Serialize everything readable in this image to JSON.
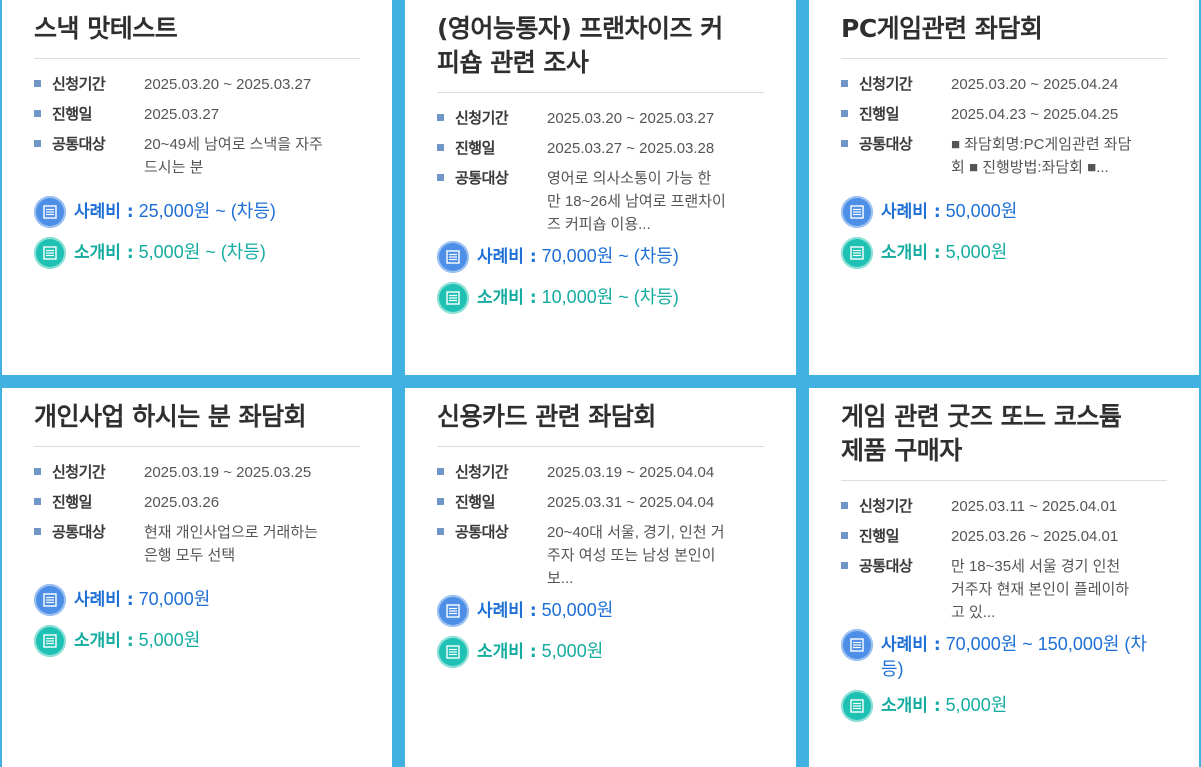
{
  "labels": {
    "apply_period": "신청기간",
    "event_date": "진행일",
    "target": "공통대상",
    "reward": "사례비 :",
    "referral": "소개비 :"
  },
  "colors": {
    "background": "#41b1e2",
    "reward_text": "#1e6fd6",
    "referral_text": "#14aca0",
    "bullet": "#6f95c9"
  },
  "cards": [
    {
      "title_lines": [
        "스낵 맛테스트"
      ],
      "apply_period": "2025.03.20 ~ 2025.03.27",
      "event_date": "2025.03.27",
      "target_lines": [
        "20~49세 남여로 스낵을 자주",
        "드시는 분"
      ],
      "reward": "25,000원 ~ (차등)",
      "referral": "5,000원 ~ (차등)"
    },
    {
      "title_lines": [
        "(영어능통자) 프랜차이즈 커",
        "피숍 관련 조사"
      ],
      "apply_period": "2025.03.20 ~ 2025.03.27",
      "event_date": "2025.03.27 ~ 2025.03.28",
      "target_lines": [
        "영어로 의사소통이 가능 한",
        "만 18~26세 남여로 프랜차이",
        "즈 커피숍 이용..."
      ],
      "reward": "70,000원 ~ (차등)",
      "referral": "10,000원 ~ (차등)"
    },
    {
      "title_lines": [
        "PC게임관련 좌담회"
      ],
      "apply_period": "2025.03.20 ~ 2025.04.24",
      "event_date": "2025.04.23 ~ 2025.04.25",
      "target_lines": [
        "■ 좌담회명:PC게임관련 좌담",
        "회 ■ 진행방법:좌담회 ■..."
      ],
      "reward": "50,000원",
      "referral": "5,000원"
    },
    {
      "title_lines": [
        "개인사업 하시는 분 좌담회"
      ],
      "apply_period": "2025.03.19 ~ 2025.03.25",
      "event_date": "2025.03.26",
      "target_lines": [
        "현재 개인사업으로 거래하는",
        "은행 모두 선택"
      ],
      "reward": "70,000원",
      "referral": "5,000원"
    },
    {
      "title_lines": [
        "신용카드 관련 좌담회"
      ],
      "apply_period": "2025.03.19 ~ 2025.04.04",
      "event_date": "2025.03.31 ~ 2025.04.04",
      "target_lines": [
        "20~40대 서울, 경기, 인천 거",
        "주자 여성 또는 남성 본인이",
        "보..."
      ],
      "reward": "50,000원",
      "referral": "5,000원"
    },
    {
      "title_lines": [
        "게임 관련 굿즈 또느 코스튬",
        "제품 구매자"
      ],
      "apply_period": "2025.03.11 ~ 2025.04.01",
      "event_date": "2025.03.26 ~ 2025.04.01",
      "target_lines": [
        "만 18~35세 서울 경기 인천",
        "거주자 현재 본인이 플레이하",
        "고 있..."
      ],
      "reward_lines": [
        "70,000원 ~ 150,000원 (차",
        "등)"
      ],
      "referral": "5,000원"
    }
  ]
}
